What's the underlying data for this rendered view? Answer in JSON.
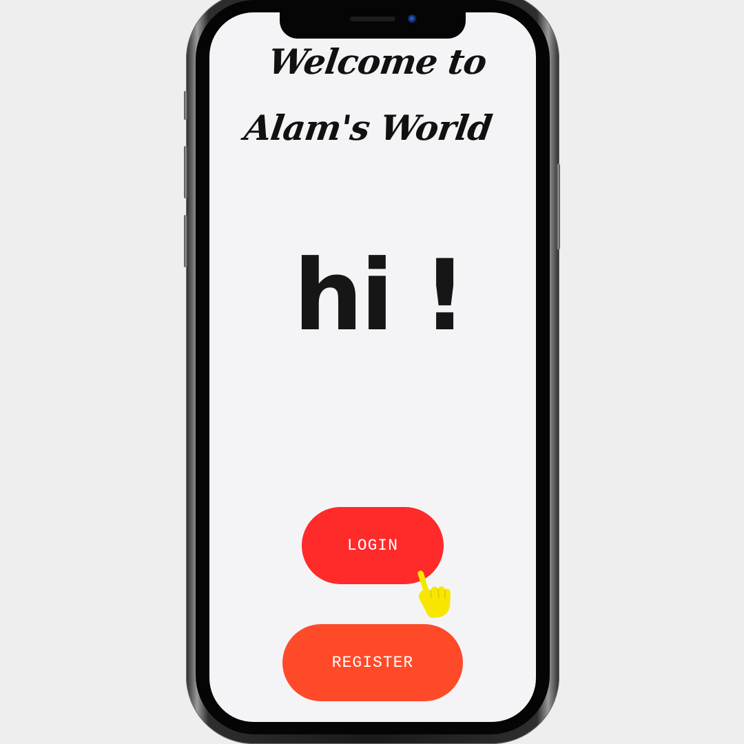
{
  "screen": {
    "title": "Welcome to Alam's World",
    "greeting": "hi !"
  },
  "actions": {
    "login_label": "LOGIN",
    "register_label": "REGISTER"
  },
  "icons": {
    "pointer": "hand-pointer-icon",
    "camera": "front-camera-icon"
  },
  "colors": {
    "login_button": "#ff2a2a",
    "register_button": "#ff4a2a",
    "screen_background": "#f4f4f6",
    "pointer": "#f7e600"
  }
}
